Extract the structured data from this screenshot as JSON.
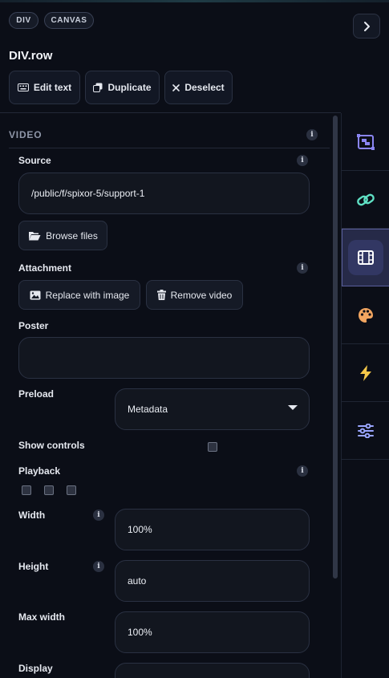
{
  "header": {
    "badges": [
      "DIV",
      "CANVAS"
    ],
    "element_title": "DIV.row",
    "actions": {
      "edit_text": "Edit text",
      "duplicate": "Duplicate",
      "deselect": "Deselect"
    }
  },
  "section": {
    "title": "VIDEO",
    "source": {
      "label": "Source",
      "value": "/public/f/spixor-5/support-1"
    },
    "browse_label": "Browse files",
    "attachment": {
      "label": "Attachment",
      "replace_label": "Replace with image",
      "remove_label": "Remove video"
    },
    "poster": {
      "label": "Poster",
      "value": ""
    },
    "preload": {
      "label": "Preload",
      "value": "Metadata"
    },
    "show_controls": {
      "label": "Show controls",
      "checked": false
    },
    "playback": {
      "label": "Playback",
      "options_checked": [
        false,
        false,
        false
      ]
    },
    "width": {
      "label": "Width",
      "value": "100%"
    },
    "height": {
      "label": "Height",
      "value": "auto"
    },
    "max_width": {
      "label": "Max width",
      "value": "100%"
    },
    "display": {
      "label": "Display",
      "value": ""
    }
  },
  "rail": {
    "items": [
      "layout-icon",
      "link-icon",
      "film-icon",
      "palette-icon",
      "lightning-icon",
      "sliders-icon"
    ],
    "active": "film-icon",
    "colors": {
      "layout": "#8a85f2",
      "link": "#5fe0c4",
      "film": "#ffffff",
      "palette": "#f2a560",
      "lightning": "#f5c84a",
      "sliders": "#9aa6ff"
    }
  },
  "colors": {
    "background": "#0b0e17",
    "field": "#12161f",
    "border": "#2a3142",
    "active_rail": "#262a48"
  }
}
